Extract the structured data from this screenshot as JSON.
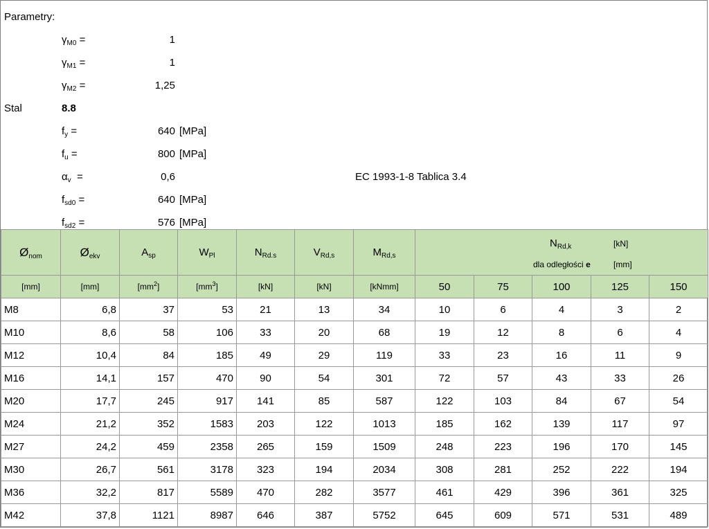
{
  "params": {
    "title": "Parametry:",
    "gM0": {
      "sym": "γ",
      "sub": "M0",
      "eq": "=",
      "val": "1"
    },
    "gM1": {
      "sym": "γ",
      "sub": "M1",
      "eq": "=",
      "val": "1"
    },
    "gM2": {
      "sym": "γ",
      "sub": "M2",
      "eq": "=",
      "val": "1,25"
    },
    "stal": {
      "label": "Stal",
      "grade": "8.8"
    },
    "fy": {
      "sym": "f",
      "sub": "y",
      "eq": "=",
      "val": "640",
      "unit": "[MPa]"
    },
    "fu": {
      "sym": "f",
      "sub": "u",
      "eq": "=",
      "val": "800",
      "unit": "[MPa]"
    },
    "av": {
      "sym": "α",
      "sub": "v",
      "eq": "=",
      "val": "0,6",
      "note": "EC 1993-1-8 Tablica 3.4"
    },
    "fsd0": {
      "sym": "f",
      "sub": "sd0",
      "eq": "=",
      "val": "640",
      "unit": "[MPa]"
    },
    "fsd2": {
      "sym": "f",
      "sub": "sd2",
      "eq": "=",
      "val": "576",
      "unit": "[MPa]"
    }
  },
  "table": {
    "headers": {
      "dnom": {
        "sym": "Ø",
        "sub": "nom"
      },
      "dekv": {
        "sym": "Ø",
        "sub": "ekv"
      },
      "asp": {
        "sym": "A",
        "sub": "sp"
      },
      "wpl": {
        "sym": "W",
        "sub": "Pl"
      },
      "nrd": {
        "sym": "N",
        "sub": "Rd.s"
      },
      "vrd": {
        "sym": "V",
        "sub": "Rd,s"
      },
      "mrd": {
        "sym": "M",
        "sub": "Rd,s"
      },
      "nrdk": {
        "sym": "N",
        "sub": "Rd,k",
        "unit": "[kN]",
        "desc": "dla odległości",
        "desc_bold": "e",
        "unit2": "[mm]"
      }
    },
    "units": {
      "dnom": "[mm]",
      "dekv": "[mm]",
      "asp_pre": "[mm",
      "asp_sup": "2",
      "post": "]",
      "wpl_pre": "[mm",
      "wpl_sup": "3",
      "nrd": "[kN]",
      "vrd": "[kN]",
      "mrd": "[kNmm]"
    },
    "e_values": [
      "50",
      "75",
      "100",
      "125",
      "150"
    ],
    "rows": [
      {
        "name": "M8",
        "dekv": "6,8",
        "asp": "37",
        "wpl": "53",
        "nrd": "21",
        "vrd": "13",
        "mrd": "34",
        "k": [
          "10",
          "6",
          "4",
          "3",
          "2"
        ]
      },
      {
        "name": "M10",
        "dekv": "8,6",
        "asp": "58",
        "wpl": "106",
        "nrd": "33",
        "vrd": "20",
        "mrd": "68",
        "k": [
          "19",
          "12",
          "8",
          "6",
          "4"
        ]
      },
      {
        "name": "M12",
        "dekv": "10,4",
        "asp": "84",
        "wpl": "185",
        "nrd": "49",
        "vrd": "29",
        "mrd": "119",
        "k": [
          "33",
          "23",
          "16",
          "11",
          "9"
        ]
      },
      {
        "name": "M16",
        "dekv": "14,1",
        "asp": "157",
        "wpl": "470",
        "nrd": "90",
        "vrd": "54",
        "mrd": "301",
        "k": [
          "72",
          "57",
          "43",
          "33",
          "26"
        ]
      },
      {
        "name": "M20",
        "dekv": "17,7",
        "asp": "245",
        "wpl": "917",
        "nrd": "141",
        "vrd": "85",
        "mrd": "587",
        "k": [
          "122",
          "103",
          "84",
          "67",
          "54"
        ]
      },
      {
        "name": "M24",
        "dekv": "21,2",
        "asp": "352",
        "wpl": "1583",
        "nrd": "203",
        "vrd": "122",
        "mrd": "1013",
        "k": [
          "185",
          "162",
          "139",
          "117",
          "97"
        ]
      },
      {
        "name": "M27",
        "dekv": "24,2",
        "asp": "459",
        "wpl": "2358",
        "nrd": "265",
        "vrd": "159",
        "mrd": "1509",
        "k": [
          "248",
          "223",
          "196",
          "170",
          "145"
        ]
      },
      {
        "name": "M30",
        "dekv": "26,7",
        "asp": "561",
        "wpl": "3178",
        "nrd": "323",
        "vrd": "194",
        "mrd": "2034",
        "k": [
          "308",
          "281",
          "252",
          "222",
          "194"
        ]
      },
      {
        "name": "M36",
        "dekv": "32,2",
        "asp": "817",
        "wpl": "5589",
        "nrd": "470",
        "vrd": "282",
        "mrd": "3577",
        "k": [
          "461",
          "429",
          "396",
          "361",
          "325"
        ]
      },
      {
        "name": "M42",
        "dekv": "37,8",
        "asp": "1121",
        "wpl": "8987",
        "nrd": "646",
        "vrd": "387",
        "mrd": "5752",
        "k": [
          "645",
          "609",
          "571",
          "531",
          "489"
        ]
      }
    ]
  }
}
